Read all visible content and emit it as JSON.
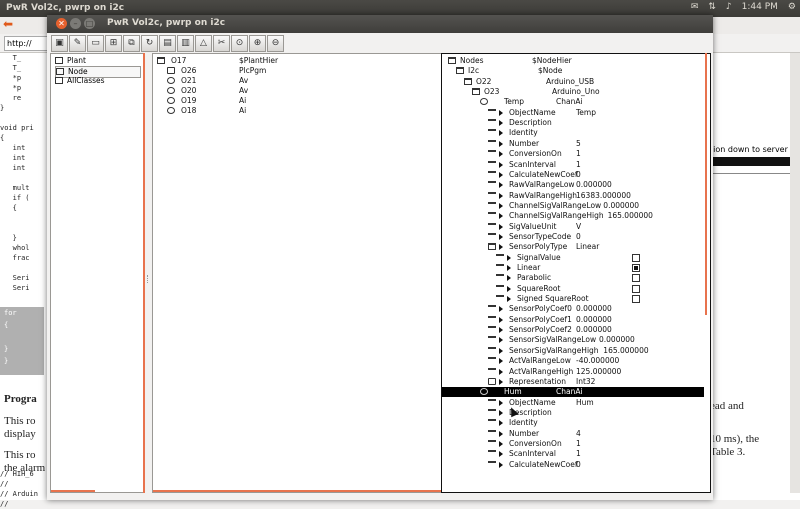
{
  "top_panel": {
    "app_title": "PwR Vol2c, pwrp on i2c",
    "time": "1:44 PM"
  },
  "background": {
    "url": "http://",
    "code_lines": [
      "   T_",
      "   T_",
      "   *p",
      "   *p",
      "   re",
      "}",
      "",
      "void pri",
      "{",
      "   int",
      "   int",
      "   int",
      "",
      "   mult",
      "   if (",
      "   {",
      "",
      "",
      "   }",
      "   whol",
      "   frac",
      "",
      "   Seri",
      "   Seri"
    ],
    "gray_code": [
      "for",
      "{",
      "",
      "}",
      "}"
    ],
    "heading": "Progra",
    "para1": "This ro",
    "para1b": "display",
    "para2": "This ro",
    "para2b": "the alarm p",
    "code2": [
      "// HIH_6",
      "//",
      "// Arduin",
      "//"
    ],
    "right_line": "tion down to server",
    "right_text1": "ead and",
    "right_text2": "10 ms), the",
    "right_text3": "Table 3."
  },
  "window": {
    "title": "PwR Vol2c,  pwrp on i2c",
    "toolbar_icons": [
      "save-icon",
      "edit-icon",
      "disabled-icon",
      "network-icon",
      "copy-icon",
      "refresh-icon",
      "archive-icon",
      "book-icon",
      "alarm-icon",
      "tools-icon",
      "zoom-reset-icon",
      "zoom-in-icon",
      "zoom-out-icon"
    ]
  },
  "pane1": {
    "items": [
      "Plant",
      "Node",
      "AllClasses"
    ]
  },
  "pane2": {
    "rows": [
      {
        "obj": "O17",
        "cls": "$PlantHier",
        "icon": "folder"
      },
      {
        "obj": "O26",
        "cls": "PlcPgm",
        "icon": "node"
      },
      {
        "obj": "O21",
        "cls": "Av",
        "icon": "eye"
      },
      {
        "obj": "O20",
        "cls": "Av",
        "icon": "eye"
      },
      {
        "obj": "O19",
        "cls": "Ai",
        "icon": "eye"
      },
      {
        "obj": "O18",
        "cls": "Ai",
        "icon": "eye"
      }
    ]
  },
  "pane3": {
    "rows": [
      {
        "indent": 0,
        "icon": "folder",
        "tri": false,
        "name": "Nodes",
        "val": "$NodeHier"
      },
      {
        "indent": 1,
        "icon": "folder",
        "tri": false,
        "name": "I2c",
        "val": "$Node"
      },
      {
        "indent": 2,
        "icon": "folder",
        "tri": false,
        "name": "O22",
        "val": "Arduino_USB"
      },
      {
        "indent": 3,
        "icon": "folder",
        "tri": false,
        "name": "O23",
        "val": "Arduino_Uno"
      },
      {
        "indent": 4,
        "icon": "eye",
        "tri": false,
        "name": "Temp",
        "val": "ChanAi"
      },
      {
        "indent": 5,
        "icon": "attr",
        "tri": true,
        "name": "ObjectName",
        "val": "Temp"
      },
      {
        "indent": 5,
        "icon": "attr",
        "tri": true,
        "name": "Description",
        "val": ""
      },
      {
        "indent": 5,
        "icon": "attr",
        "tri": true,
        "name": "Identity",
        "val": ""
      },
      {
        "indent": 5,
        "icon": "attr",
        "tri": true,
        "name": "Number",
        "val": "5"
      },
      {
        "indent": 5,
        "icon": "attr",
        "tri": true,
        "name": "ConversionOn",
        "val": "1"
      },
      {
        "indent": 5,
        "icon": "attr",
        "tri": true,
        "name": "ScanInterval",
        "val": "1"
      },
      {
        "indent": 5,
        "icon": "attr",
        "tri": true,
        "name": "CalculateNewCoef",
        "val": "0"
      },
      {
        "indent": 5,
        "icon": "attr",
        "tri": true,
        "name": "RawValRangeLow",
        "val": "0.000000"
      },
      {
        "indent": 5,
        "icon": "attr",
        "tri": true,
        "name": "RawValRangeHigh",
        "val": "16383.000000"
      },
      {
        "indent": 5,
        "icon": "attr",
        "tri": true,
        "name": "ChannelSigValRangeLow",
        "val": "0.000000"
      },
      {
        "indent": 5,
        "icon": "attr",
        "tri": true,
        "name": "ChannelSigValRangeHigh",
        "val": "165.000000"
      },
      {
        "indent": 5,
        "icon": "attr",
        "tri": true,
        "name": "SigValueUnit",
        "val": "V"
      },
      {
        "indent": 5,
        "icon": "attr",
        "tri": true,
        "name": "SensorTypeCode",
        "val": "0"
      },
      {
        "indent": 5,
        "icon": "folder",
        "tri": true,
        "name": "SensorPolyType",
        "val": "Linear"
      },
      {
        "indent": 6,
        "icon": "attr",
        "tri": true,
        "name": "SignalValue",
        "val": "",
        "check": "off"
      },
      {
        "indent": 6,
        "icon": "attr",
        "tri": true,
        "name": "Linear",
        "val": "",
        "check": "on"
      },
      {
        "indent": 6,
        "icon": "attr",
        "tri": true,
        "name": "Parabolic",
        "val": "",
        "check": "off"
      },
      {
        "indent": 6,
        "icon": "attr",
        "tri": true,
        "name": "SquareRoot",
        "val": "",
        "check": "off"
      },
      {
        "indent": 6,
        "icon": "attr",
        "tri": true,
        "name": "Signed SquareRoot",
        "val": "",
        "check": "off"
      },
      {
        "indent": 5,
        "icon": "attr",
        "tri": true,
        "name": "SensorPolyCoef0",
        "val": "0.000000"
      },
      {
        "indent": 5,
        "icon": "attr",
        "tri": true,
        "name": "SensorPolyCoef1",
        "val": "0.000000"
      },
      {
        "indent": 5,
        "icon": "attr",
        "tri": true,
        "name": "SensorPolyCoef2",
        "val": "0.000000"
      },
      {
        "indent": 5,
        "icon": "attr",
        "tri": true,
        "name": "SensorSigValRangeLow",
        "val": "0.000000"
      },
      {
        "indent": 5,
        "icon": "attr",
        "tri": true,
        "name": "SensorSigValRangeHigh",
        "val": "165.000000"
      },
      {
        "indent": 5,
        "icon": "attr",
        "tri": true,
        "name": "ActValRangeLow",
        "val": "-40.000000"
      },
      {
        "indent": 5,
        "icon": "attr",
        "tri": true,
        "name": "ActValRangeHigh",
        "val": "125.000000"
      },
      {
        "indent": 5,
        "icon": "node",
        "tri": true,
        "name": "Representation",
        "val": "Int32"
      },
      {
        "indent": 4,
        "icon": "eye",
        "tri": false,
        "name": "Hum",
        "val": "ChanAi",
        "selected": true
      },
      {
        "indent": 5,
        "icon": "attr",
        "tri": true,
        "name": "ObjectName",
        "val": "Hum"
      },
      {
        "indent": 5,
        "icon": "attr",
        "tri": true,
        "name": "Description",
        "val": ""
      },
      {
        "indent": 5,
        "icon": "attr",
        "tri": true,
        "name": "Identity",
        "val": ""
      },
      {
        "indent": 5,
        "icon": "attr",
        "tri": true,
        "name": "Number",
        "val": "4"
      },
      {
        "indent": 5,
        "icon": "attr",
        "tri": true,
        "name": "ConversionOn",
        "val": "1"
      },
      {
        "indent": 5,
        "icon": "attr",
        "tri": true,
        "name": "ScanInterval",
        "val": "1"
      },
      {
        "indent": 5,
        "icon": "attr",
        "tri": true,
        "name": "CalculateNewCoef",
        "val": "0"
      }
    ]
  },
  "colors": {
    "accent": "#e8734d",
    "selection": "#000000",
    "panel": "#3c3b37"
  }
}
